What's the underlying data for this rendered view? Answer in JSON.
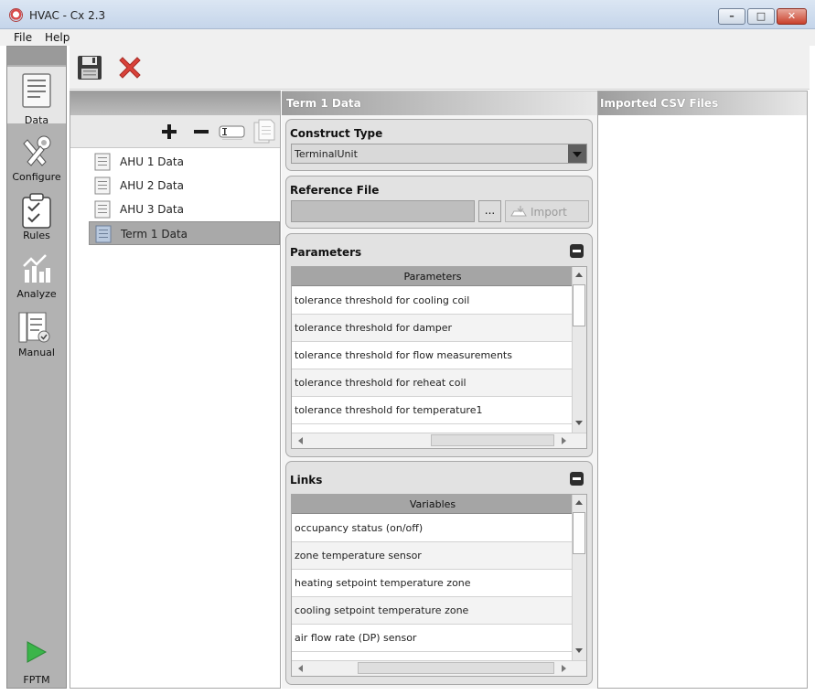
{
  "window": {
    "title": "HVAC - Cx 2.3"
  },
  "menu": {
    "file": "File",
    "help": "Help"
  },
  "sidebar": {
    "items": [
      {
        "label": "Data",
        "icon": "data-icon",
        "active": true
      },
      {
        "label": "Configure",
        "icon": "tools-icon"
      },
      {
        "label": "Rules",
        "icon": "clipboard-check-icon"
      },
      {
        "label": "Analyze",
        "icon": "chart-icon"
      },
      {
        "label": "Manual",
        "icon": "manual-icon"
      }
    ],
    "fptm": "FPTM"
  },
  "tree": {
    "items": [
      "AHU 1 Data",
      "AHU 2 Data",
      "AHU 3 Data",
      "Term 1 Data"
    ],
    "selected": "Term 1 Data"
  },
  "middle": {
    "header": "Term 1 Data",
    "construct_type": {
      "title": "Construct Type",
      "value": "TerminalUnit"
    },
    "reference_file": {
      "title": "Reference File",
      "value": "",
      "browse": "...",
      "import": "Import"
    },
    "parameters": {
      "title": "Parameters",
      "column": "Parameters",
      "rows": [
        "tolerance threshold for cooling coil",
        "tolerance threshold for damper",
        "tolerance threshold for flow measurements",
        "tolerance threshold for reheat coil",
        "tolerance threshold for temperature1"
      ]
    },
    "links": {
      "title": "Links",
      "column": "Variables",
      "rows": [
        "occupancy status (on/off)",
        "zone temperature sensor",
        "heating setpoint temperature zone",
        "cooling setpoint temperature zone",
        "air flow rate (DP) sensor"
      ]
    }
  },
  "right": {
    "header": "Imported CSV Files"
  },
  "colors": {
    "panel_bg": "#e2e2e2",
    "sidebar_bg": "#b2b2b2",
    "cancel_red": "#d9423a",
    "run_green": "#3bb54a"
  }
}
